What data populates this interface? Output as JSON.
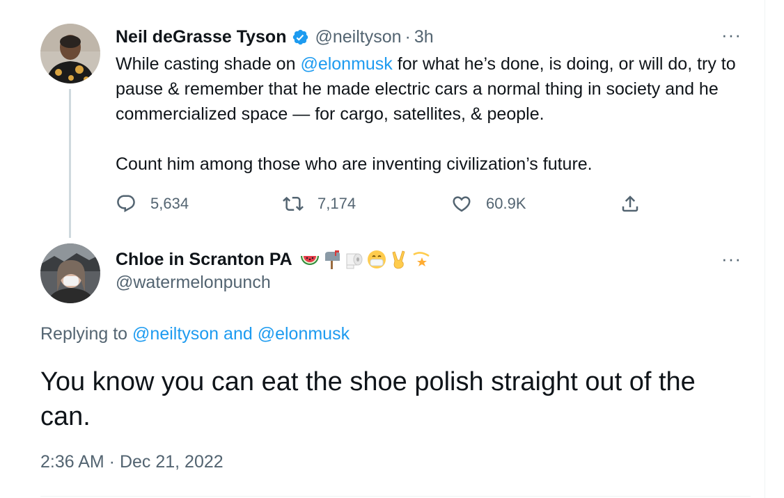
{
  "original_tweet": {
    "author_name": "Neil deGrasse Tyson",
    "handle": "@neiltyson",
    "separator": "·",
    "time_ago": "3h",
    "more_label": "···",
    "text_parts": {
      "p1_before": "While casting shade on ",
      "p1_mention": "@elonmusk",
      "p1_after": " for what he’s done, is doing, or will do, try to pause & remember that he made electric cars a normal thing in society and he commercialized space — for cargo, satellites, & people.",
      "p2": "Count him among those who are inventing civilization’s future."
    },
    "actions": {
      "replies": "5,634",
      "retweets": "7,174",
      "likes": "60.9K"
    }
  },
  "reply_tweet": {
    "author_name": "Chloe in Scranton PA",
    "handle": "@watermelonpunch",
    "more_label": "···",
    "name_emojis": [
      "watermelon-emoji",
      "mailbox-emoji",
      "toilet-paper-emoji",
      "face-with-mask-emoji",
      "victory-hand-emoji",
      "dizzy-star-emoji"
    ],
    "replying_prefix": "Replying to ",
    "replying_mention_1": "@neiltyson",
    "replying_joiner": " and ",
    "replying_mention_2": "@elonmusk",
    "text": "You know you can eat the shoe polish straight out of the can.",
    "timestamp": "2:36 AM · Dec 21, 2022"
  },
  "colors": {
    "accent": "#1d9bf0",
    "text_primary": "#0f1419",
    "text_secondary": "#536471",
    "thread_line": "#cfd9de"
  }
}
